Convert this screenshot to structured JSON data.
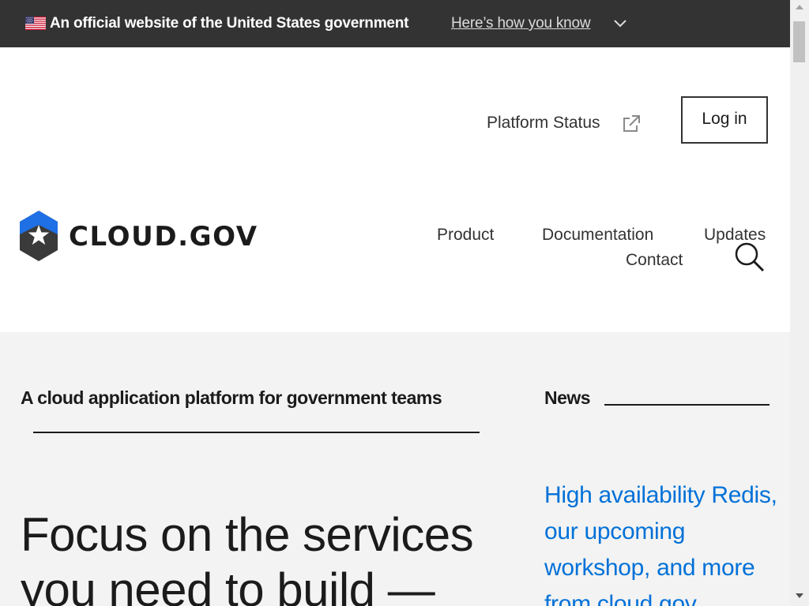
{
  "gov_banner": {
    "text": "An official website of the United States government",
    "link_label": "Here’s how you know"
  },
  "header": {
    "status_link": "Platform Status",
    "login_label": "Log in",
    "logo_text": "CLOUD.GOV",
    "nav": {
      "product": "Product",
      "documentation": "Documentation",
      "updates": "Updates",
      "contact": "Contact"
    }
  },
  "main": {
    "tagline": "A cloud application platform for government teams",
    "hero": "Focus on the services you need to build —",
    "news_heading": "News",
    "news_link": "High availability Redis, our upcoming workshop, and more from cloud.gov"
  },
  "colors": {
    "banner_bg": "#333333",
    "main_bg": "#f3f3f3",
    "link_blue": "#0071d8",
    "logo_blue": "#1f6fe5"
  },
  "icons": {
    "flag": "us-flag-icon",
    "chevron": "chevron-down-icon",
    "external": "external-link-icon",
    "search": "search-icon"
  }
}
